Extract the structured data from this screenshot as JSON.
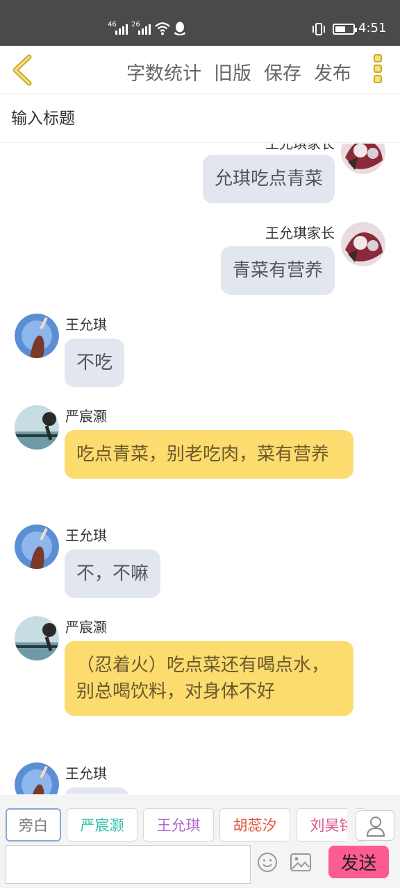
{
  "status_bar": {
    "network_1": "46",
    "network_2": "26",
    "battery_level": 0.6,
    "time": "4:51"
  },
  "toolbar": {
    "actions": [
      "字数统计",
      "旧版",
      "保存",
      "发布"
    ],
    "accent_color": "#f6e27a"
  },
  "title_input": {
    "placeholder": "输入标题",
    "value": ""
  },
  "messages": [
    {
      "name": "王允琪家长",
      "text": "允琪吃点青菜",
      "side": "right",
      "style": "gray"
    },
    {
      "name": "王允琪家长",
      "text": "青菜有营养",
      "side": "right",
      "style": "gray"
    },
    {
      "name": "王允琪",
      "text": "不吃",
      "side": "left",
      "style": "gray"
    },
    {
      "name": "严宸灏",
      "text": "吃点青菜，别老吃肉，菜有营养",
      "side": "left",
      "style": "yellow"
    },
    {
      "name": "王允琪",
      "text": "不，不嘛",
      "side": "left",
      "style": "gray"
    },
    {
      "name": "严宸灏",
      "text": "（忍着火）吃点菜还有喝点水，别总喝饮料，对身体不好",
      "side": "left",
      "style": "yellow"
    },
    {
      "name": "王允琪",
      "text": "",
      "side": "left",
      "style": "gray"
    }
  ],
  "characters": [
    {
      "label": "旁白",
      "color": "#777777"
    },
    {
      "label": "严宸灏",
      "color": "#3bbfb0"
    },
    {
      "label": "王允琪",
      "color": "#b06ad0"
    },
    {
      "label": "胡蕊汐",
      "color": "#e0503c"
    },
    {
      "label": "刘昊铭",
      "color": "#e0508a"
    }
  ],
  "composer": {
    "placeholder": "",
    "send_label": "发送",
    "send_color": "#fc5c92"
  },
  "bubble_colors": {
    "gray": "#e2e7ef",
    "yellow": "#fcdb6f"
  }
}
